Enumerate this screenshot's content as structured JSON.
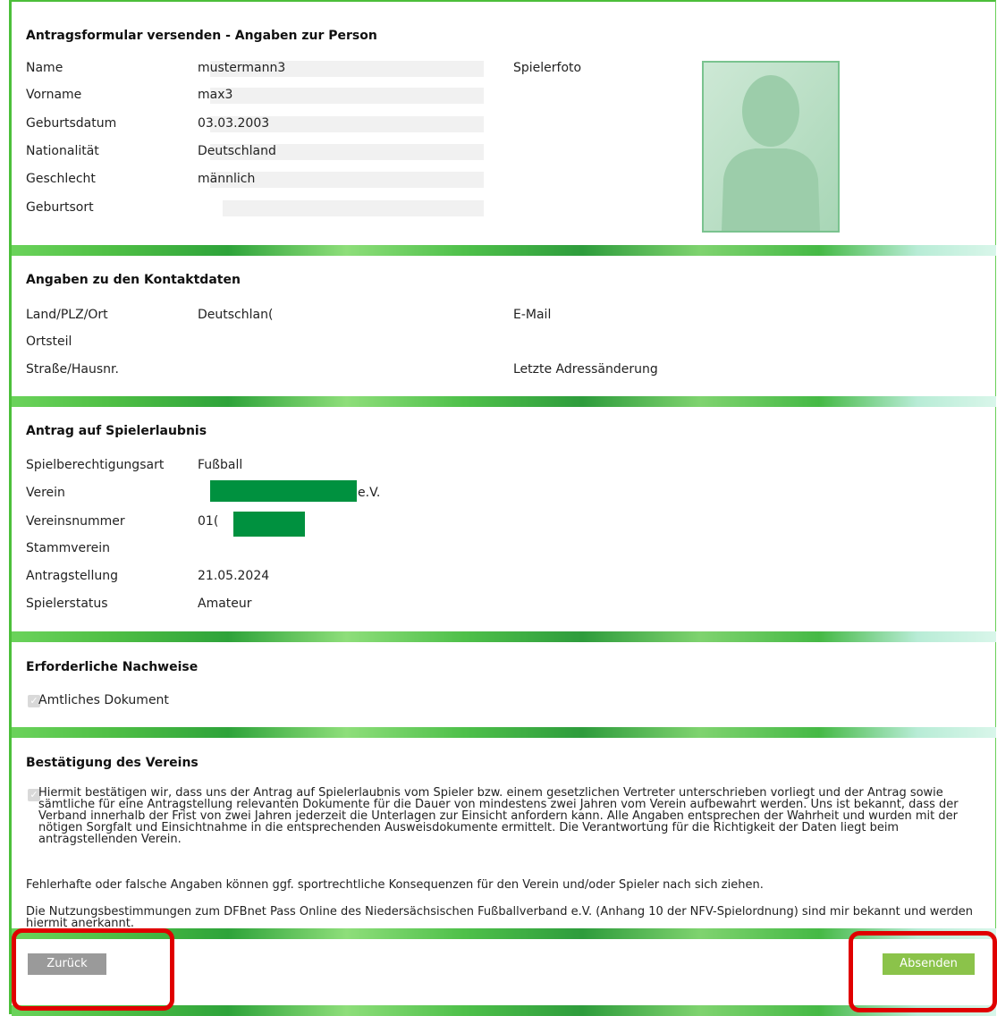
{
  "section_person": {
    "title": "Antragsformular versenden - Angaben zur Person",
    "rows": [
      {
        "label": "Name",
        "value": "mustermann3"
      },
      {
        "label": "Vorname",
        "value": "max3"
      },
      {
        "label": "Geburtsdatum",
        "value": "03.03.2003"
      },
      {
        "label": "Nationalität",
        "value": "Deutschland"
      },
      {
        "label": "Geschlecht",
        "value": "männlich"
      },
      {
        "label": "Geburtsort",
        "value": ""
      }
    ],
    "photo_label": "Spielerfoto"
  },
  "section_contact": {
    "title": "Angaben zu den Kontaktdaten",
    "rows": [
      {
        "label": "Land/PLZ/Ort",
        "value": "Deutschlan("
      },
      {
        "label": "Ortsteil",
        "value": ""
      },
      {
        "label": "Straße/Hausnr.",
        "value": ""
      }
    ],
    "right_labels": [
      "E-Mail",
      "Letzte Adressänderung"
    ]
  },
  "section_permission": {
    "title": "Antrag auf Spielerlaubnis",
    "rows": [
      {
        "label": "Spielberechtigungsart",
        "value": "Fußball"
      },
      {
        "label": "Verein",
        "value": "e.V."
      },
      {
        "label": "Vereinsnummer",
        "value": "01("
      },
      {
        "label": "Stammverein",
        "value": ""
      },
      {
        "label": "Antragstellung",
        "value": "21.05.2024"
      },
      {
        "label": "Spielerstatus",
        "value": "Amateur"
      }
    ]
  },
  "section_proof": {
    "title": "Erforderliche Nachweise",
    "item": "Amtliches Dokument"
  },
  "section_confirm": {
    "title": "Bestätigung des Vereins",
    "para1": "Hiermit bestätigen wir, dass uns der Antrag auf Spielerlaubnis vom Spieler bzw. einem gesetzlichen Vertreter unterschrieben vorliegt und der Antrag sowie sämtliche für eine Antragstellung relevanten Dokumente für die Dauer von mindestens zwei Jahren vom Verein aufbewahrt werden. Uns ist bekannt, dass der Verband innerhalb der Frist von zwei Jahren jederzeit die Unterlagen zur Einsicht anfordern kann. Alle Angaben entsprechen der Wahrheit und wurden mit der nötigen Sorgfalt und Einsichtnahme in die entsprechenden Ausweisdokumente ermittelt. Die Verantwortung für die Richtigkeit der Daten liegt beim antragstellenden Verein.",
    "para2": "Fehlerhafte oder falsche Angaben können ggf. sportrechtliche Konsequenzen für den Verein und/oder Spieler nach sich ziehen.",
    "para3": "Die Nutzungsbestimmungen zum DFBnet Pass Online des Niedersächsischen Fußballverband e.V. (Anhang 10 der NFV-Spielordnung) sind mir bekannt und werden hiermit anerkannt."
  },
  "buttons": {
    "back": "Zurück",
    "send": "Absenden"
  },
  "colors": {
    "accent_green": "#4cbf3a",
    "send_button": "#8bc34a",
    "back_button": "#9a9a9a",
    "highlight": "#e00000",
    "redaction": "#00913f"
  }
}
